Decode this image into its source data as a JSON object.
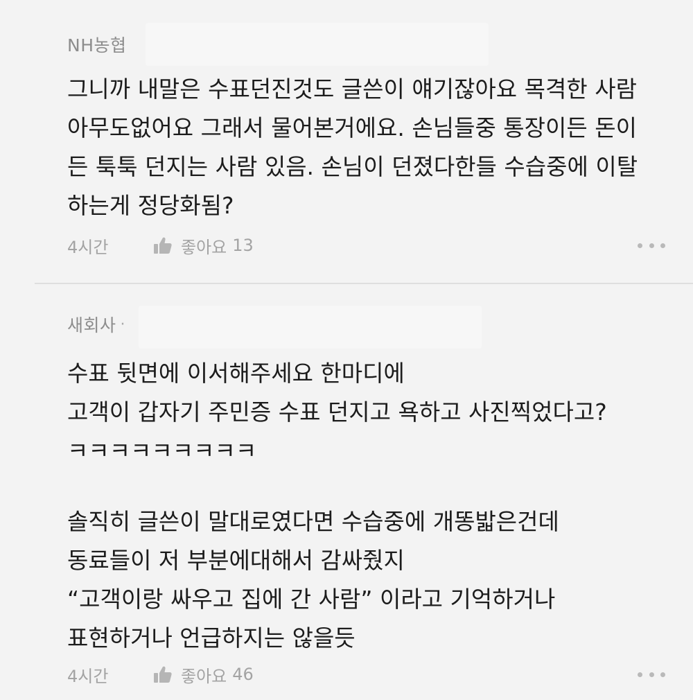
{
  "comments": [
    {
      "company": "NH농협",
      "show_dot": false,
      "lines": [
        "그니까 내말은 수표던진것도 글쓴이 얘기잖아요 목격한 사람",
        "아무도없어요 그래서 물어본거에요. 손님들중 통장이든 돈이",
        "든 툭툭 던지는 사람 있음. 손님이 던졌다한들 수습중에 이탈",
        "하는게 정당화됨?"
      ],
      "time": "4시간",
      "like_label": "좋아요",
      "like_count": "13"
    },
    {
      "company": "새회사",
      "show_dot": true,
      "dot": "·",
      "lines_1": [
        "수표 뒷면에 이서해주세요 한마디에",
        "고객이 갑자기 주민증 수표 던지고 욕하고 사진찍었다고?",
        "ㅋㅋㅋㅋㅋㅋㅋㅋㅋ"
      ],
      "lines_2": [
        "솔직히 글쓴이 말대로였다면 수습중에 개똥밟은건데",
        "동료들이 저 부분에대해서 감싸줬지",
        "“고객이랑 싸우고 집에 간 사람” 이라고 기억하거나",
        "표현하거나 언급하지는 않을듯"
      ],
      "time": "4시간",
      "like_label": "좋아요",
      "like_count": "46"
    }
  ],
  "icons": {
    "like": "thumbs-up-icon",
    "more": "more-horizontal-icon"
  },
  "colors": {
    "background": "#f3f3f3",
    "text": "#1c1c1c",
    "meta": "#a3a3a3",
    "company": "#8d8d8d"
  }
}
